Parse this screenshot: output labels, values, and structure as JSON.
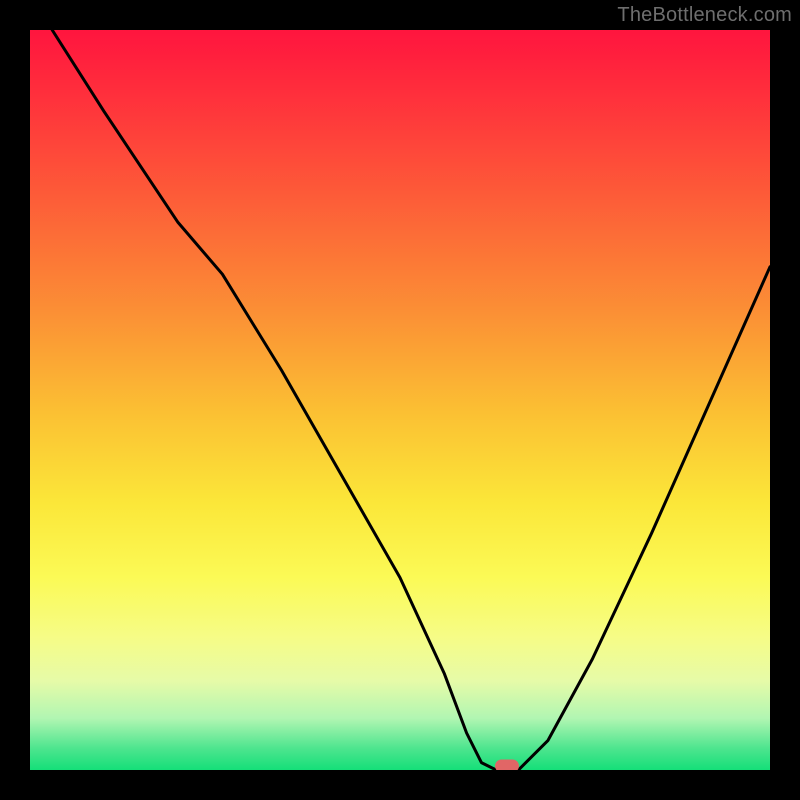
{
  "watermark": "TheBottleneck.com",
  "chart_data": {
    "type": "line",
    "title": "",
    "xlabel": "",
    "ylabel": "",
    "xlim": [
      0,
      100
    ],
    "ylim": [
      0,
      100
    ],
    "series": [
      {
        "name": "bottleneck-curve",
        "x": [
          3,
          10,
          20,
          26,
          34,
          42,
          50,
          56,
          59,
          61,
          63,
          66,
          70,
          76,
          84,
          92,
          100
        ],
        "y": [
          100,
          89,
          74,
          67,
          54,
          40,
          26,
          13,
          5,
          1,
          0,
          0,
          4,
          15,
          32,
          50,
          68
        ]
      }
    ],
    "marker": {
      "x": 64.5,
      "y": 0.5
    },
    "colors": {
      "curve": "#000000",
      "marker": "#e16666",
      "gradient_top": "#ff153e",
      "gradient_bottom": "#14df79"
    }
  }
}
